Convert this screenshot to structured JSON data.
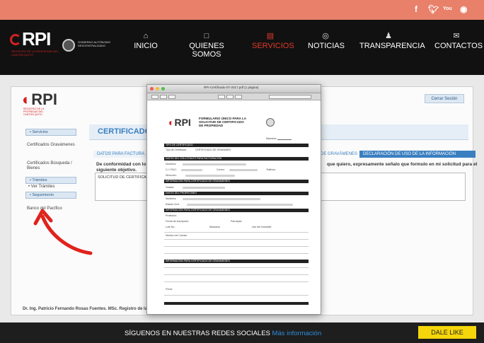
{
  "social": {
    "facebook": "f",
    "twitter": "t",
    "youtube": "You",
    "instagram": "ig"
  },
  "header": {
    "logo": "RPI",
    "logo_subtitle": "REGISTRO DE LA PROPIEDAD DEL CANTÓN QUITO",
    "gov_text": "GOBIERNO AUTÓNOMO DESCENTRALIZADO",
    "nav": [
      {
        "label": "INICIO",
        "icon": "home-icon"
      },
      {
        "label": "QUIENES SOMOS",
        "icon": "document-icon"
      },
      {
        "label": "SERVICIOS",
        "icon": "folder-icon",
        "active": true
      },
      {
        "label": "NOTICIAS",
        "icon": "globe-icon"
      },
      {
        "label": "TRANSPARENCIA",
        "icon": "user-icon"
      },
      {
        "label": "CONTACTOS",
        "icon": "mail-icon"
      }
    ]
  },
  "app": {
    "logo": "RPI",
    "logo_subtitle": "REGISTRO DE LA PROPIEDAD DEL CANTÓN QUITO",
    "close_session": "Cerrar Sesión",
    "title": "CERTIFICADO",
    "sidebar": {
      "tramites_top": "• Servicios",
      "cert_gravamenes": "Certificados Gravámenes",
      "cert_busqueda": "Certificados Búsqueda / Bienes",
      "tramites": "• Trámites",
      "ver_tramites": "• Ver Trámites",
      "seguimiento": "• Seguimiento",
      "botones_pacifico": "Banco del Pacífico"
    },
    "tabs": {
      "tab1": "DATOS PARA FACTURA",
      "tab2": "DE GRAVÁMENES",
      "tab3": "DECLARACIÓN DE USO DE LA INFORMACIÓN"
    },
    "para_left": "De conformidad con lo d",
    "para_left2": "siguiente objetivo.",
    "para_right": "que quiero, expresamente señalo que formulo en mi solicitud para el",
    "textarea": "SOLICITUD DE CERTIFICA",
    "footer": "Dr. Ing. Patricio Fernando Rosas Fuentes. MSc. Registro de la"
  },
  "pdf": {
    "title": "RPI-Certificado-07-2017.pdf (1 página)",
    "logo": "RPI",
    "heading": "FORMULARIO ÚNICO PARA LA SOLICITUD DE CERTIFICADO DE PROPIEDAD",
    "number_label": "Número:",
    "sections": [
      "TIPO DE CERTIFICADO",
      "DATOS DEL SOLICITANTE PARA FACTURACIÓN",
      "INFORMACIÓN PARA CERTIFICADO DE GRAVÁMENES",
      "DATOS DEL PROPIETARIO",
      "INFORMACIÓN PARA CERTIFICADO DE GRAVÁMENES",
      "INFORMACIÓN PARA CERTIFICADO DE GRAVÁMENES"
    ],
    "fields": {
      "tipo": "Tipo de Certificado:",
      "tipo_val": "CERTIFICADO DE GRAVAMEN",
      "nombres": "Nombres:",
      "ci": "C.I / RUC:",
      "correo": "Correo:",
      "telefono": "Teléfono:",
      "direccion": "Dirección:",
      "cedula": "Cédula:",
      "estado": "Estado Civil:",
      "profesion": "Profesión:",
      "fecha": "Fecha de Inscripción:",
      "parroquia": "Parroquia:",
      "lote": "Lote No.:",
      "manzana": "Manzana:",
      "uso": "Uso del Inmueble:",
      "cuenta": "Número de Cuenta:",
      "firma": "Firma:"
    }
  },
  "bottom": {
    "follow": "SÍGUENOS EN NUESTRAS REDES SOCIALES",
    "more": "Más información",
    "like": "DALE LIKE"
  }
}
